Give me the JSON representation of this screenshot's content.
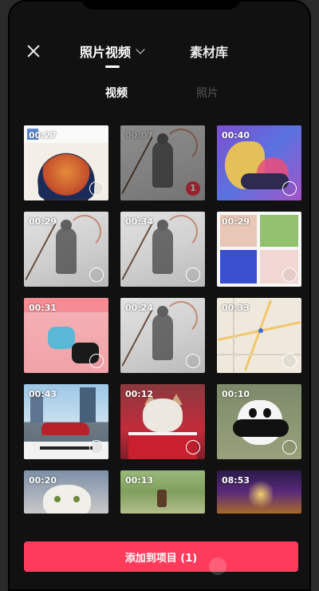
{
  "header": {
    "tab_photos_videos": "照片视频",
    "tab_library": "素材库"
  },
  "sub_tabs": {
    "video": "视频",
    "photo": "照片"
  },
  "grid": {
    "items": [
      {
        "duration": "00:27",
        "selected": false
      },
      {
        "duration": "00:07",
        "selected": true,
        "selection_index": "1"
      },
      {
        "duration": "00:40",
        "selected": false
      },
      {
        "duration": "00:29",
        "selected": false
      },
      {
        "duration": "00:34",
        "selected": false
      },
      {
        "duration": "00:29",
        "selected": false
      },
      {
        "duration": "00:31",
        "selected": false
      },
      {
        "duration": "00:24",
        "selected": false
      },
      {
        "duration": "00:33",
        "selected": false
      },
      {
        "duration": "00:43",
        "selected": false
      },
      {
        "duration": "00:12",
        "selected": false
      },
      {
        "duration": "00:10",
        "selected": false
      },
      {
        "duration": "00:20",
        "selected": false
      },
      {
        "duration": "00:13",
        "selected": false
      },
      {
        "duration": "08:53",
        "selected": false
      }
    ]
  },
  "footer": {
    "add_button_label": "添加到项目 (1)"
  },
  "colors": {
    "accent": "#ff3b5c",
    "badge": "#f0364b",
    "background": "#111111"
  },
  "icons": {
    "close": "close-icon",
    "dropdown": "chevron-down-icon"
  }
}
